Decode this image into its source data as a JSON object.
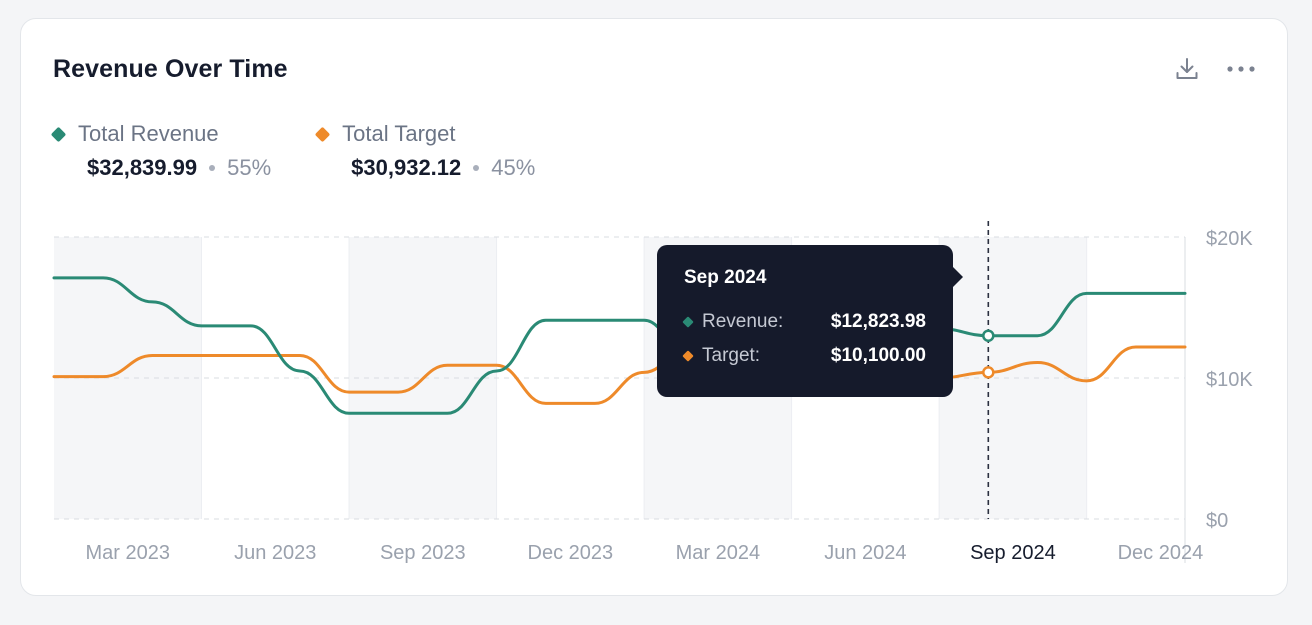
{
  "card": {
    "title": "Revenue Over Time",
    "actions": [
      {
        "name": "download",
        "icon": "download-icon"
      },
      {
        "name": "more",
        "icon": "more-horizontal-icon"
      }
    ]
  },
  "legend": [
    {
      "label": "Total Revenue",
      "amount": "$32,839.99",
      "percent": "55%",
      "color": "#2a8a75"
    },
    {
      "label": "Total Target",
      "amount": "$30,932.12",
      "percent": "45%",
      "color": "#ee8a2a"
    }
  ],
  "tooltip": {
    "title": "Sep 2024",
    "rows": [
      {
        "label": "Revenue:",
        "value": "$12,823.98",
        "color": "#2a8a75"
      },
      {
        "label": "Target:",
        "value": "$10,100.00",
        "color": "#ee8a2a"
      }
    ]
  },
  "chart_data": {
    "type": "line",
    "x_tick_labels": [
      "Mar 2023",
      "Jun 2023",
      "Sep 2023",
      "Dec 2023",
      "Mar 2024",
      "Jun 2024",
      "Sep 2024",
      "Dec 2024"
    ],
    "active_tick": "Sep 2024",
    "y_tick_labels": [
      "$20K",
      "$10K",
      "$0"
    ],
    "ylim": [
      0,
      20000
    ],
    "y_ticks": [
      20000,
      10000,
      0
    ],
    "x": [
      "Feb 2023",
      "Mar 2023",
      "Apr 2023",
      "May 2023",
      "Jun 2023",
      "Jul 2023",
      "Aug 2023",
      "Sep 2023",
      "Oct 2023",
      "Nov 2023",
      "Dec 2023",
      "Jan 2024",
      "Feb 2024",
      "Mar 2024",
      "Apr 2024",
      "May 2024",
      "Jun 2024",
      "Jul 2024",
      "Aug 2024",
      "Sep 2024",
      "Oct 2024",
      "Nov 2024",
      "Dec 2024",
      "Jan 2025"
    ],
    "series": [
      {
        "name": "Total Revenue",
        "color": "#2a8a75",
        "values": [
          17100,
          17100,
          15400,
          13700,
          13700,
          10500,
          7500,
          7500,
          7500,
          10500,
          14100,
          14100,
          14100,
          10900,
          10900,
          10900,
          12500,
          13500,
          13500,
          13000,
          13000,
          16000,
          16000,
          16000
        ]
      },
      {
        "name": "Total Target",
        "color": "#ee8a2a",
        "values": [
          10100,
          10100,
          11600,
          11600,
          11600,
          11600,
          9000,
          9000,
          10900,
          10900,
          8200,
          8200,
          10400,
          12600,
          12100,
          9000,
          9000,
          10000,
          10000,
          10400,
          11100,
          9800,
          12200,
          12200
        ]
      }
    ],
    "highlight_index": 19,
    "grid": true,
    "legend_position": "top-left"
  }
}
